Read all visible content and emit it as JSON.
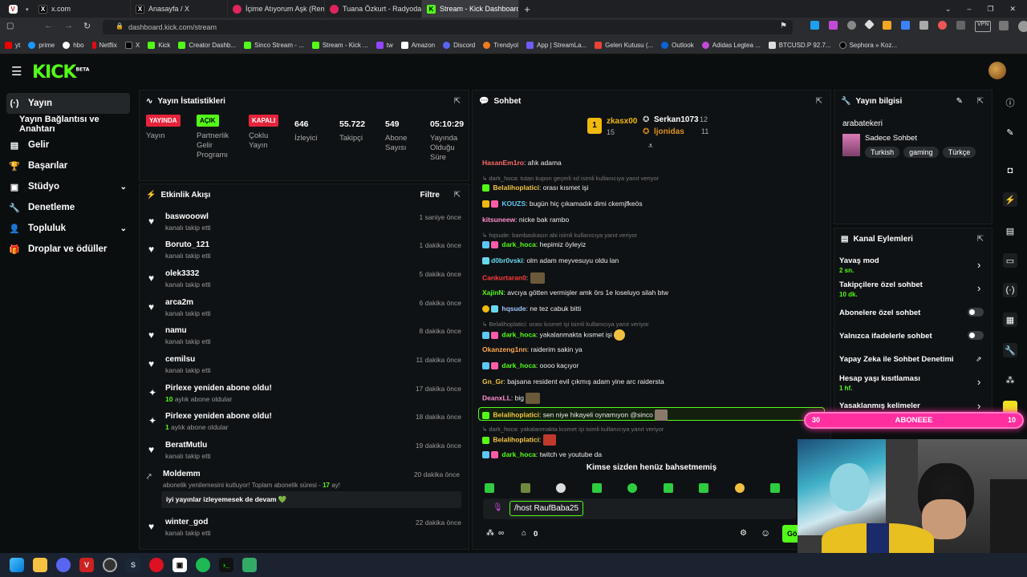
{
  "browser": {
    "tabs": [
      {
        "title": "x.com",
        "icon": "x-icon"
      },
      {
        "title": "Anasayfa / X",
        "icon": "x-icon"
      },
      {
        "title": "İçime Atıyorum Aşk (Remix",
        "icon": "youtube-music-icon"
      },
      {
        "title": "Tuana Özkurt - Radyoda N",
        "icon": "youtube-music-icon"
      },
      {
        "title": "Stream - Kick Dashboard",
        "icon": "kick-icon"
      }
    ],
    "url": "dashboard.kick.com/stream",
    "bookmarks": [
      "yt",
      "prime",
      "hbo",
      "Netflix",
      "X",
      "Kick",
      "Creator Dashb...",
      "Sinco Stream - ...",
      "Stream - Kick ...",
      "tw",
      "Amazon",
      "Discord",
      "Trendyol",
      "App | StreamLa...",
      "Gelen Kutusu (...",
      "Outlook",
      "Adidas Legtea ...",
      "BTCUSD.P 92.7...",
      "Sephora » Koz..."
    ],
    "vpn_label": "VPN"
  },
  "brand": {
    "logo": "KICK",
    "beta": "BETA",
    "accent": "#53fc18"
  },
  "sidebar": {
    "items": [
      {
        "label": "Yayın",
        "icon": "broadcast-icon"
      },
      {
        "label": "Yayın Bağlantısı ve Anahtarı",
        "icon": ""
      },
      {
        "label": "Gelir",
        "icon": "revenue-icon"
      },
      {
        "label": "Başarılar",
        "icon": "trophy-icon"
      },
      {
        "label": "Stüdyo",
        "icon": "studio-icon"
      },
      {
        "label": "Denetleme",
        "icon": "wrench-icon"
      },
      {
        "label": "Topluluk",
        "icon": "community-icon"
      },
      {
        "label": "Droplar ve ödüller",
        "icon": "drops-icon"
      }
    ]
  },
  "stats": {
    "title": "Yayın İstatistikleri",
    "items": [
      {
        "badge": "YAYINDA",
        "label": "Yayın"
      },
      {
        "badge": "AÇIK",
        "label": "Partnerlik Gelir Programı"
      },
      {
        "badge": "KAPALI",
        "label": "Çoklu Yayın"
      },
      {
        "value": "646",
        "label": "İzleyici"
      },
      {
        "value": "55.722",
        "label": "Takipçi"
      },
      {
        "value": "549",
        "label": "Abone Sayısı"
      },
      {
        "value": "05:10:29",
        "label": "Yayında Olduğu Süre"
      }
    ]
  },
  "activity": {
    "title": "Etkinlik Akışı",
    "filter": "Filtre",
    "items": [
      {
        "name": "baswooowl",
        "sub": "kanalı takip etti",
        "time": "1 saniye önce",
        "type": "follow"
      },
      {
        "name": "Boruto_121",
        "sub": "kanalı takip etti",
        "time": "1 dakika önce",
        "type": "follow"
      },
      {
        "name": "olek3332",
        "sub": "kanalı takip etti",
        "time": "5 dakika önce",
        "type": "follow"
      },
      {
        "name": "arca2m",
        "sub": "kanalı takip etti",
        "time": "6 dakika önce",
        "type": "follow"
      },
      {
        "name": "namu",
        "sub": "kanalı takip etti",
        "time": "8 dakika önce",
        "type": "follow"
      },
      {
        "name": "cemilsu",
        "sub": "kanalı takip etti",
        "time": "11 dakika önce",
        "type": "follow"
      },
      {
        "name": "Pirlexe yeniden abone oldu!",
        "count": "10",
        "sub": " aylık abone oldular",
        "time": "17 dakika önce",
        "type": "sub"
      },
      {
        "name": "Pirlexe yeniden abone oldu!",
        "count": "1",
        "sub": " aylık abone oldular",
        "time": "18 dakika önce",
        "type": "sub"
      },
      {
        "name": "BeratMutlu",
        "sub": "kanalı takip etti",
        "time": "19 dakika önce",
        "type": "follow"
      },
      {
        "name": "Moldemm",
        "sub": "abonelik yenilemesini kutluyor! Toplam abonelik süresi - ",
        "count": "17",
        "sub2": " ay!",
        "message": "iyi yayınlar izleyemesek de devam 💚",
        "time": "20 dakika önce",
        "type": "resub"
      },
      {
        "name": "winter_god",
        "sub": "kanalı takip etti",
        "time": "22 dakika önce",
        "type": "follow"
      }
    ]
  },
  "chat": {
    "title": "Sohbet",
    "leaders": [
      {
        "rank": "1",
        "name": "zkasx00",
        "count": "15"
      },
      {
        "name": "Serkan1073",
        "count": "12"
      },
      {
        "name": "ljonidas",
        "count": "11"
      }
    ],
    "messages": [
      {
        "user": "HasanEm1ro",
        "color": "#ff6b6b",
        "text": "afık adama"
      },
      {
        "reply": "dark_hoca: tutan kupon geçerli xd isimli kullanıcıya yanıt veriyor"
      },
      {
        "user": "Belalihoplatici",
        "color": "#f4c542",
        "text": "orası kısmet işi"
      },
      {
        "user": "KOUZS",
        "color": "#5bc8f5",
        "text": "bugün hiç çıkamadık dimi ckemjfkeös"
      },
      {
        "user": "kitsuneew",
        "color": "#ff8ccf",
        "text": "nicke bak rambo"
      },
      {
        "reply": "hqsude: bambaskasın abi isimli kullanıcıya yanıt veriyor"
      },
      {
        "user": "dark_hoca",
        "color": "#53fc18",
        "text": "hepimiz öyleyiz"
      },
      {
        "user": "d0br0vski",
        "color": "#66d9ef",
        "text": "olm adam meyvesuyu oldu lan"
      },
      {
        "user": "Cankurtaran0",
        "color": "#ff3b3b",
        "text": ""
      },
      {
        "user": "XajinN",
        "color": "#53fc18",
        "text": "avcıya götten vermişler amk örs 1e loseluyo silah btw"
      },
      {
        "user": "hqsude",
        "color": "#a0c4ff",
        "text": "ne tez cabuk bitti"
      },
      {
        "reply": "Belalihoplatici: orası kısmet işi isimli kullanıcıya yanıt veriyor"
      },
      {
        "user": "dark_hoca",
        "color": "#53fc18",
        "text": "yakalanmakta kısmet işi"
      },
      {
        "user": "Okanzeng1nn",
        "color": "#ffa94d",
        "text": "raiderim sakin ya"
      },
      {
        "user": "dark_hoca",
        "color": "#53fc18",
        "text": "oooo kaçıyor"
      },
      {
        "user": "Gn_Gr",
        "color": "#f4c542",
        "text": "bajsana resident evil çıkmış adam yine arc raidersta"
      },
      {
        "user": "DeanxLL",
        "color": "#ff8ccf",
        "text": "big"
      },
      {
        "user": "Belalihoplatici",
        "color": "#f4c542",
        "text": "sen niye hikayeli oynamıyon @sinco",
        "highlight": true
      },
      {
        "reply": "dark_hoca: yakalanmakta kısmet işi isimli kullanıcıya yanıt veriyor"
      },
      {
        "user": "Belalihoplatici",
        "color": "#f4c542",
        "text": ""
      },
      {
        "user": "dark_hoca",
        "color": "#53fc18",
        "text": "twitch ve youtube da"
      }
    ],
    "mentions_empty": "Kimse sizden henüz bahsetmemiş",
    "input_value": "/host RaufBaba25",
    "points": "0",
    "send_label": "Gö"
  },
  "info": {
    "title": "Yayın bilgisi",
    "stream_title": "arabatekeri",
    "category": "Sadece Sohbet",
    "tags": [
      "Turkish",
      "gaming",
      "Türkçe"
    ]
  },
  "actions": {
    "title": "Kanal Eylemleri",
    "items": [
      {
        "label": "Yavaş mod",
        "sub": "2 sn.",
        "control": "arrow"
      },
      {
        "label": "Takipçilere özel sohbet",
        "sub": "10 dk.",
        "control": "arrow"
      },
      {
        "label": "Abonelere özel sohbet",
        "control": "toggle"
      },
      {
        "label": "Yalnızca ifadelerle sohbet",
        "control": "toggle"
      },
      {
        "label": "Yapay Zeka ile Sohbet Denetimi",
        "control": "external"
      },
      {
        "label": "Hesap yaşı kısıtlaması",
        "sub": "1 hf.",
        "control": "arrow"
      },
      {
        "label": "Yasaklanmış kelimeler",
        "control": "arrow"
      }
    ]
  },
  "overlay": {
    "left": "30",
    "label": "ABONEEE",
    "right": "10",
    "fill": 1.0
  }
}
